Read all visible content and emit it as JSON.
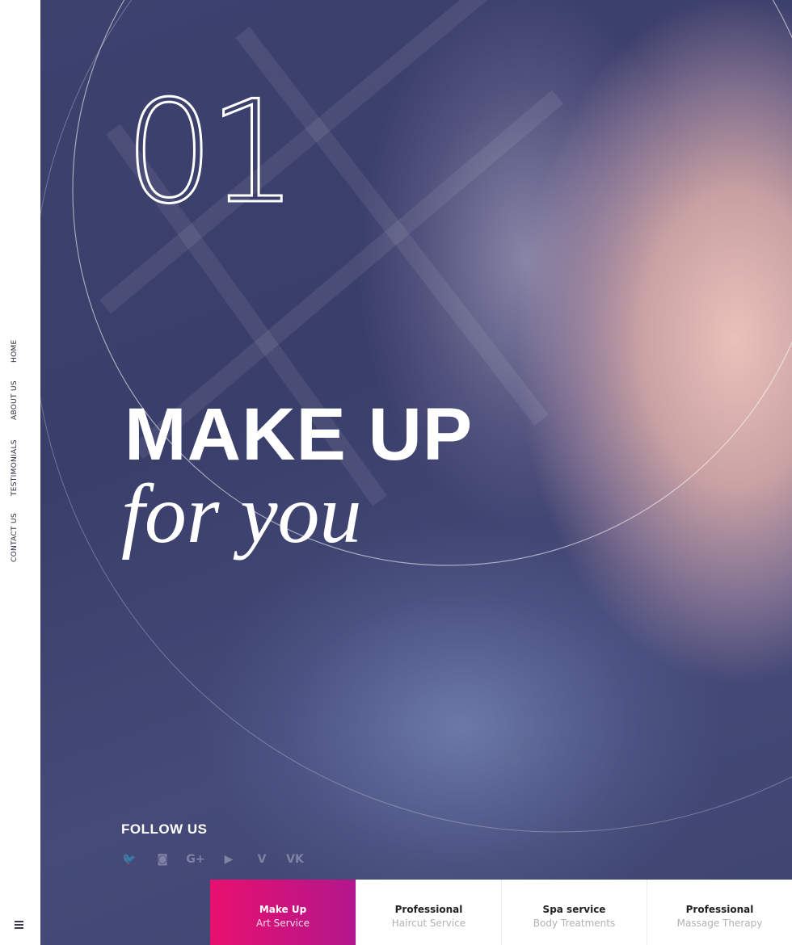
{
  "sidebar": {
    "nav": [
      {
        "label": "HOME"
      },
      {
        "label": "ABOUT US"
      },
      {
        "label": "TESTIMONIALS"
      },
      {
        "label": "CONTACT US"
      }
    ],
    "menu_icon": "hamburger-menu-icon"
  },
  "hero": {
    "slide_number": "01",
    "headline": "MAKE UP",
    "subheadline": "for you",
    "follow_label": "FOLLOW US",
    "social": [
      {
        "icon": "twitter-icon",
        "glyph": "🐦"
      },
      {
        "icon": "instagram-icon",
        "glyph": "◙"
      },
      {
        "icon": "google-plus-icon",
        "glyph": "G+"
      },
      {
        "icon": "youtube-icon",
        "glyph": "▶"
      },
      {
        "icon": "vimeo-icon",
        "glyph": "V"
      },
      {
        "icon": "vk-icon",
        "glyph": "VK"
      }
    ]
  },
  "services": [
    {
      "title": "Make Up",
      "subtitle": "Art Service",
      "active": true
    },
    {
      "title": "Professional",
      "subtitle": "Haircut Service",
      "active": false
    },
    {
      "title": "Spa service",
      "subtitle": "Body Treatments",
      "active": false
    },
    {
      "title": "Professional",
      "subtitle": "Massage Therapy",
      "active": false
    }
  ],
  "colors": {
    "accent_start": "#e8106e",
    "accent_end": "#b2178d",
    "hero_overlay": "#3d416e",
    "text_white": "#ffffff"
  }
}
